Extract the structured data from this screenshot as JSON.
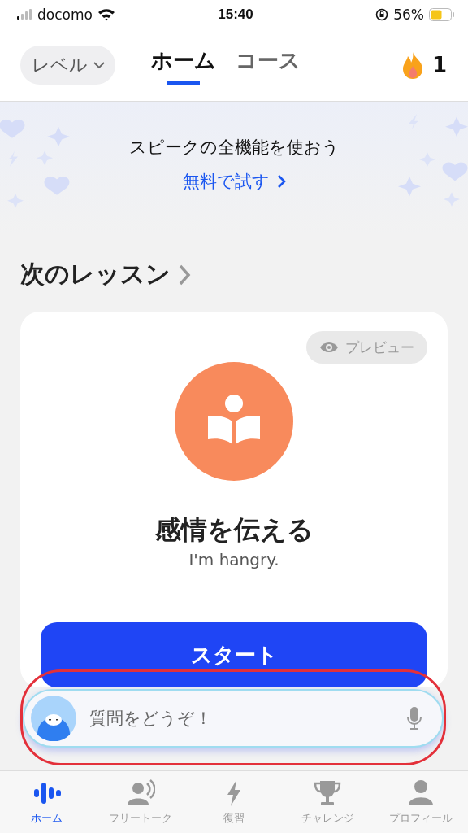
{
  "status_bar": {
    "carrier": "docomo",
    "time": "15:40",
    "battery": "56%"
  },
  "header": {
    "level_button": "レベル",
    "tabs": [
      {
        "label": "ホーム",
        "selected": true
      },
      {
        "label": "コース",
        "selected": false
      }
    ],
    "streak": "1"
  },
  "banner": {
    "title": "スピークの全機能を使おう",
    "link": "無料で試す"
  },
  "next_lesson": {
    "heading": "次のレッスン",
    "preview": "プレビュー",
    "title": "感情を伝える",
    "subtitle": "I'm hangry.",
    "start": "スタート"
  },
  "chat": {
    "placeholder": "質問をどうぞ！"
  },
  "tab_bar": [
    {
      "label": "ホーム",
      "selected": true
    },
    {
      "label": "フリートーク",
      "selected": false
    },
    {
      "label": "復習",
      "selected": false
    },
    {
      "label": "チャレンジ",
      "selected": false
    },
    {
      "label": "プロフィール",
      "selected": false
    }
  ]
}
